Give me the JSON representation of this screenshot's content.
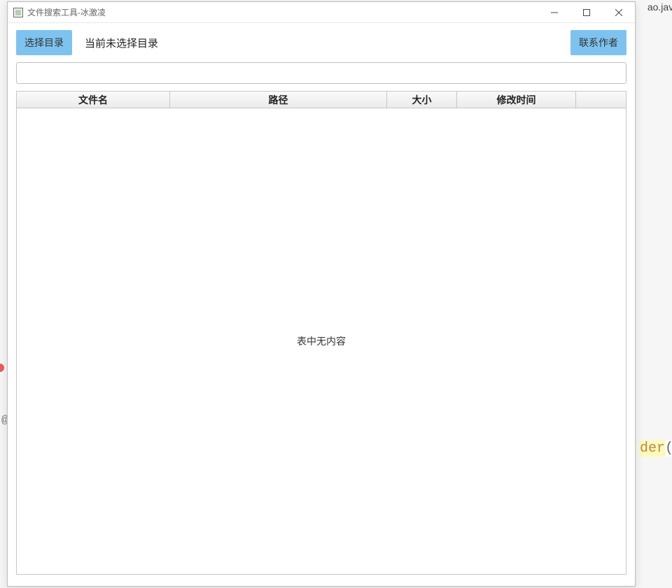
{
  "window": {
    "title": "文件搜索工具-冰激凌"
  },
  "toolbar": {
    "choose_dir_label": "选择目录",
    "status_text": "当前未选择目录",
    "contact_label": "联系作者"
  },
  "search": {
    "value": "",
    "placeholder": ""
  },
  "table": {
    "columns": {
      "name": "文件名",
      "path": "路径",
      "size": "大小",
      "mtime": "修改时间"
    },
    "empty_message": "表中无内容",
    "rows": []
  },
  "background": {
    "right_tab_text": "ao.java",
    "der_text": "der",
    "at_text": "@"
  }
}
